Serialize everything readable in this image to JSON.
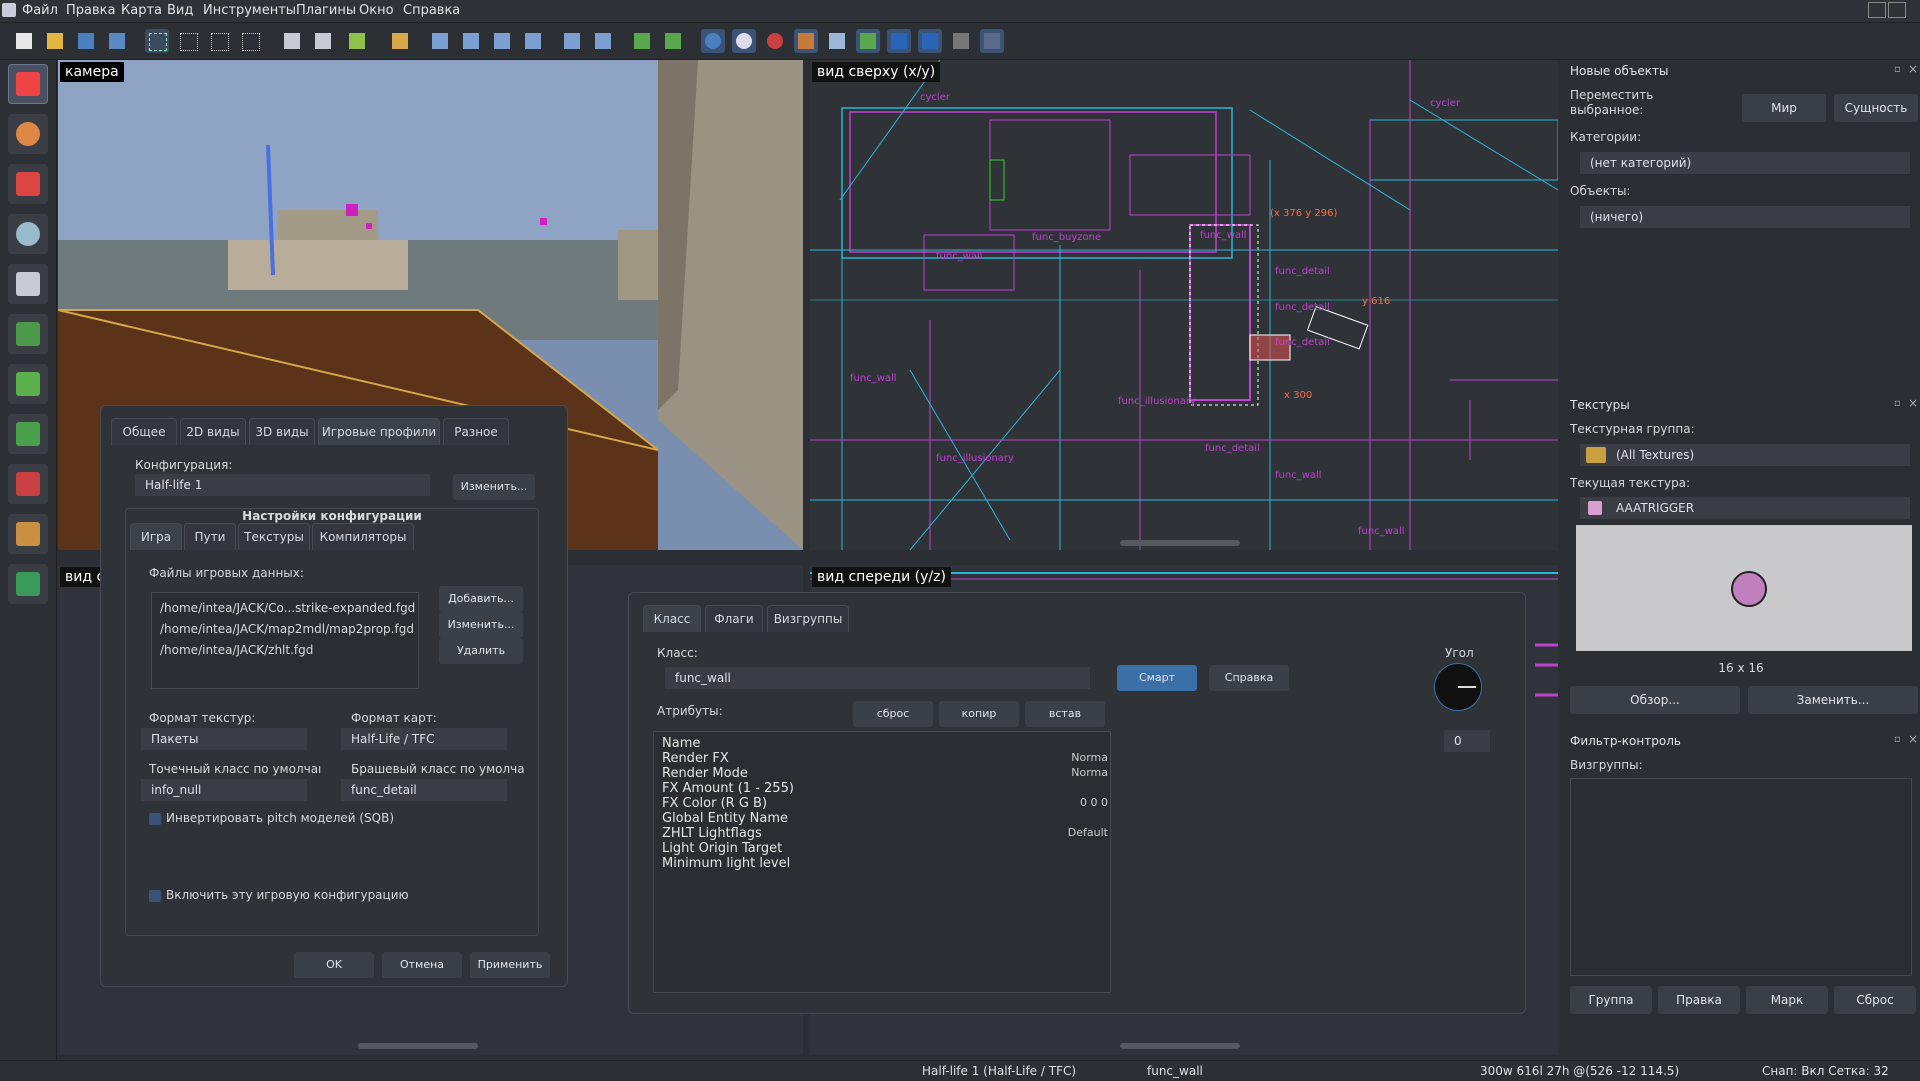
{
  "menubar": {
    "items": [
      "Файл",
      "Правка",
      "Карта",
      "Вид",
      "Инструменты",
      "Плагины",
      "Окно",
      "Справка"
    ]
  },
  "viewports": {
    "camera": "камера",
    "top": "вид сверху (x/y)",
    "side": "вид с",
    "front": "вид спереди (y/z)",
    "top_entity_labels": [
      "cycler",
      "cycler",
      "func_buyzone",
      "func_wall",
      "func_wall",
      "func_detail",
      "func_detail",
      "func_detail",
      "func_wall",
      "func_illusionary",
      "func_illusionary",
      "func_detail",
      "func_wall",
      "func_wall"
    ],
    "top_coords_1": "(x 376 y 296)",
    "top_coords_2": "y 616",
    "top_coords_3": "x 300"
  },
  "config_dialog": {
    "tabs": [
      "Общее",
      "2D виды",
      "3D виды",
      "Игровые профили",
      "Разное"
    ],
    "config_label": "Конфигурация:",
    "config_value": "Half-life 1",
    "change_btn": "Изменить...",
    "settings_header": "Настройки конфигурации",
    "subtabs": [
      "Игра",
      "Пути",
      "Текстуры",
      "Компиляторы"
    ],
    "gamedata_label": "Файлы игровых данных:",
    "gamedata_files": [
      "/home/intea/JACK/Co...strike-expanded.fgd",
      "/home/intea/JACK/map2mdl/map2prop.fgd",
      "/home/intea/JACK/zhlt.fgd"
    ],
    "add_btn": "Добавить...",
    "edit_btn": "Изменить...",
    "delete_btn": "Удалить",
    "texture_format_label": "Формат текстур:",
    "texture_format_value": "Пакеты",
    "map_format_label": "Формат карт:",
    "map_format_value": "Half-Life / TFC",
    "point_class_label": "Точечный класс по умолчаı",
    "point_class_value": "info_null",
    "brush_class_label": "Брашевый класс по умолча",
    "brush_class_value": "func_detail",
    "invert_pitch": "Инвертировать pitch моделей (SQB)",
    "enable_profile": "Включить эту игровую конфигурацию",
    "ok": "OK",
    "cancel": "Отмена",
    "apply": "Применить"
  },
  "entity_dialog": {
    "tabs": [
      "Класс",
      "Флаги",
      "Визгруппы"
    ],
    "class_label": "Класс:",
    "class_value": "func_wall",
    "smart_btn": "Смарт",
    "help_btn": "Справка",
    "angle_label": "Угол",
    "angle_value": "0",
    "attributes_label": "Атрибуты:",
    "reset_btn": "сброс",
    "copy_btn": "копир",
    "paste_btn": "встав",
    "attributes": [
      {
        "name": "Name",
        "value": ""
      },
      {
        "name": "Render FX",
        "value": "Norma"
      },
      {
        "name": "Render Mode",
        "value": "Norma"
      },
      {
        "name": "FX Amount (1 - 255)",
        "value": ""
      },
      {
        "name": "FX Color (R G B)",
        "value": "0 0 0"
      },
      {
        "name": "Global Entity Name",
        "value": ""
      },
      {
        "name": "ZHLT Lightflags",
        "value": "Default"
      },
      {
        "name": "Light Origin Target",
        "value": ""
      },
      {
        "name": "Minimum light level",
        "value": ""
      }
    ]
  },
  "new_objects": {
    "title": "Новые объекты",
    "move_label": "Переместить выбранное:",
    "world_btn": "Мир",
    "entity_btn": "Сущность",
    "categories_label": "Категории:",
    "categories_value": "(нет категорий)",
    "objects_label": "Объекты:",
    "objects_value": "(ничего)"
  },
  "textures": {
    "title": "Текстуры",
    "group_label": "Текстурная группа:",
    "group_value": "(All Textures)",
    "current_label": "Текущая текстура:",
    "current_value": "AAATRIGGER",
    "size": "16 x 16",
    "browse_btn": "Обзор...",
    "replace_btn": "Заменить..."
  },
  "filter": {
    "title": "Фильтр-контроль",
    "visgroups_label": "Визгруппы:",
    "buttons": [
      "Группа",
      "Правка",
      "Марк",
      "Сброс"
    ]
  },
  "status": {
    "game": "Half-life 1 (Half-Life / TFC)",
    "selection": "func_wall",
    "dims": "300w 616l 27h @(526 -12 114.5)",
    "snap": "Снап: Вкл Сетка: 32"
  },
  "colors": {
    "accent": "#3b6fa8",
    "brush_magenta": "#c040d0",
    "brush_cyan": "#29b6d6",
    "selection_red": "#ff6a3d"
  }
}
